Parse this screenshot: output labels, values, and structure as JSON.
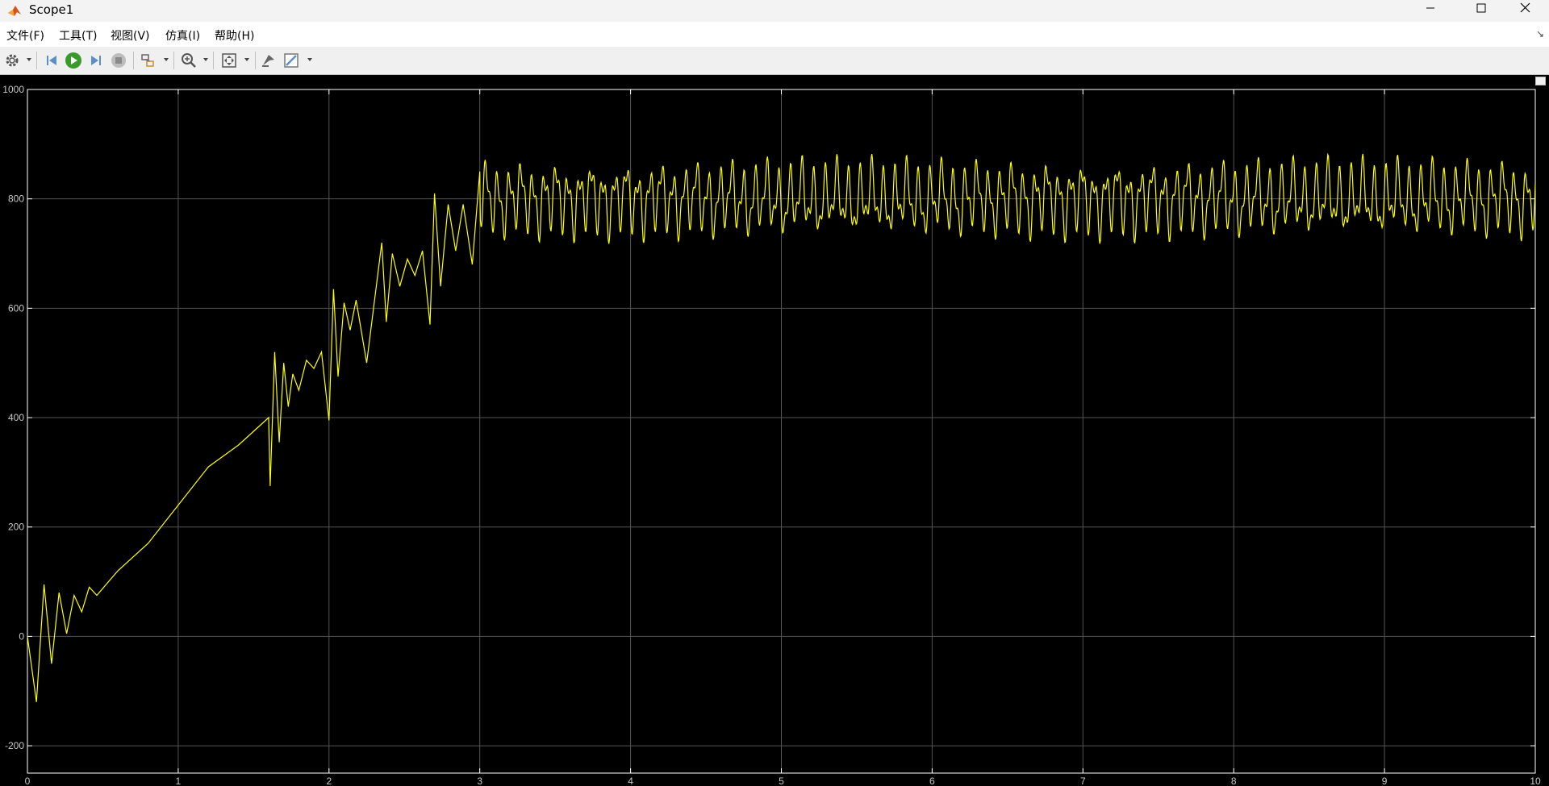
{
  "window": {
    "title": "Scope1"
  },
  "menu": {
    "items": [
      {
        "label": "文件(F)"
      },
      {
        "label": "工具(T)"
      },
      {
        "label": "视图(V)"
      },
      {
        "label": "仿真(I)"
      },
      {
        "label": "帮助(H)"
      }
    ]
  },
  "toolbar": {
    "icons": [
      "settings-icon",
      "step-back-icon",
      "run-icon",
      "step-forward-icon",
      "stop-icon",
      "signal-tools-icon",
      "zoom-icon",
      "fit-axes-icon",
      "highlight-block-icon",
      "style-icon"
    ]
  },
  "colors": {
    "trace": "#ffff00",
    "grid": "#545454",
    "axes": "#ffffff",
    "tick_text": "#c8c8c8",
    "background": "#000000"
  },
  "chart_data": {
    "type": "line",
    "title": "",
    "xlabel": "",
    "ylabel": "",
    "xlim": [
      0,
      10
    ],
    "ylim": [
      -250,
      1000
    ],
    "xticks": [
      0,
      1,
      2,
      3,
      4,
      5,
      6,
      7,
      8,
      9,
      10
    ],
    "yticks": [
      -200,
      0,
      200,
      400,
      600,
      800,
      1000
    ],
    "grid": true,
    "series": [
      {
        "x": [
          0,
          0.06,
          0.11,
          0.16,
          0.21,
          0.26,
          0.31,
          0.36,
          0.41,
          0.46,
          0.6,
          0.8,
          1.0,
          1.2,
          1.4,
          1.6,
          1.61,
          1.64,
          1.67,
          1.7,
          1.73,
          1.76,
          1.8,
          1.85,
          1.9,
          1.95,
          2.0,
          2.03,
          2.06,
          2.1,
          2.14,
          2.18,
          2.25,
          2.35,
          2.38,
          2.42,
          2.47,
          2.52,
          2.57,
          2.62,
          2.67,
          2.7,
          2.74,
          2.79,
          2.84,
          2.89,
          2.95,
          3.0
        ],
        "y": [
          0,
          -120,
          95,
          -50,
          80,
          5,
          75,
          45,
          90,
          75,
          120,
          170,
          240,
          310,
          350,
          400,
          275,
          520,
          355,
          500,
          420,
          480,
          450,
          505,
          490,
          520,
          395,
          635,
          475,
          610,
          560,
          615,
          500,
          720,
          575,
          700,
          640,
          690,
          660,
          705,
          570,
          810,
          640,
          790,
          705,
          790,
          680,
          850
        ]
      }
    ],
    "steady_state": {
      "t_start": 3.0,
      "t_end": 10.0,
      "mean": 800,
      "max": 880,
      "min": 715
    }
  }
}
